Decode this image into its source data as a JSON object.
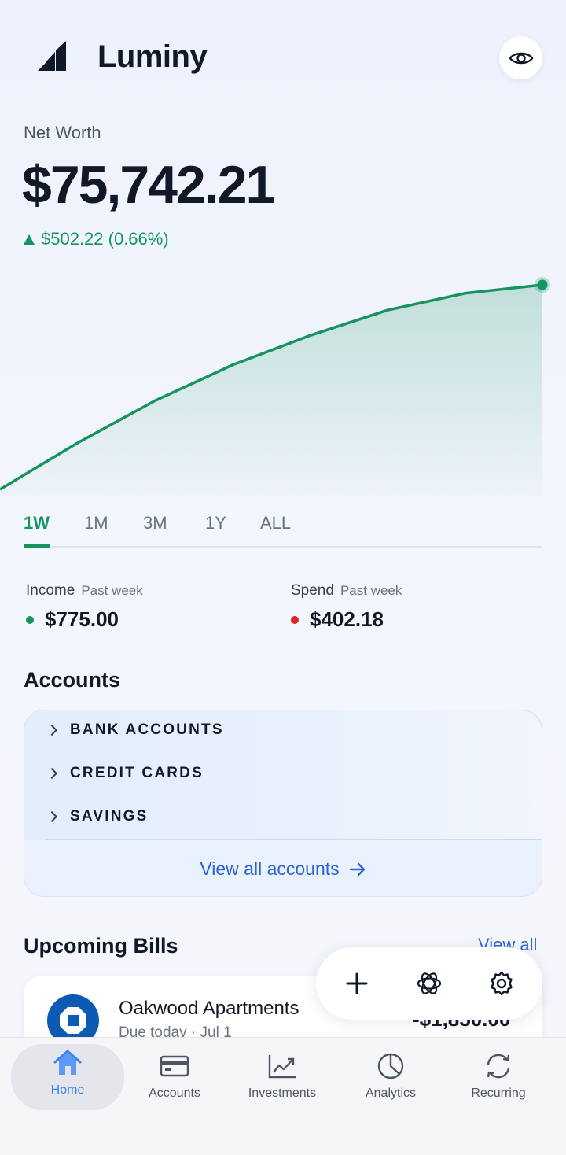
{
  "app": {
    "title": "Luminy"
  },
  "net_worth": {
    "label": "Net Worth",
    "value": "$75,742.21",
    "change": "$502.22 (0.66%)"
  },
  "chart_data": {
    "type": "area",
    "x": [
      0,
      1,
      2,
      3,
      4,
      5,
      6,
      7
    ],
    "values": [
      0,
      0.22,
      0.42,
      0.59,
      0.73,
      0.85,
      0.93,
      0.97
    ],
    "color": "#16935f"
  },
  "ranges": [
    "1W",
    "1M",
    "3M",
    "1Y",
    "ALL"
  ],
  "income": {
    "label": "Income",
    "period": "Past week",
    "value": "$775.00",
    "color": "#16935f"
  },
  "spend": {
    "label": "Spend",
    "period": "Past week",
    "value": "$402.18",
    "color": "#dc2626"
  },
  "accounts": {
    "title": "Accounts",
    "groups": [
      "BANK ACCOUNTS",
      "CREDIT CARDS",
      "SAVINGS"
    ],
    "view_all": "View all accounts"
  },
  "bills": {
    "title": "Upcoming Bills",
    "view_all": "View all",
    "items": [
      {
        "name": "Oakwood Apartments",
        "due": "Due today · Jul 1",
        "amount": "-$1,850.00"
      }
    ]
  },
  "nav": {
    "items": [
      {
        "label": "Home",
        "icon": "home-icon"
      },
      {
        "label": "Accounts",
        "icon": "card-icon"
      },
      {
        "label": "Investments",
        "icon": "investments-chart-icon"
      },
      {
        "label": "Analytics",
        "icon": "pie-chart-icon"
      },
      {
        "label": "Recurring",
        "icon": "recurring-icon"
      }
    ]
  },
  "colors": {
    "accent": "#16935f",
    "link": "#2f62d6",
    "nav_active": "#3b82f6"
  }
}
